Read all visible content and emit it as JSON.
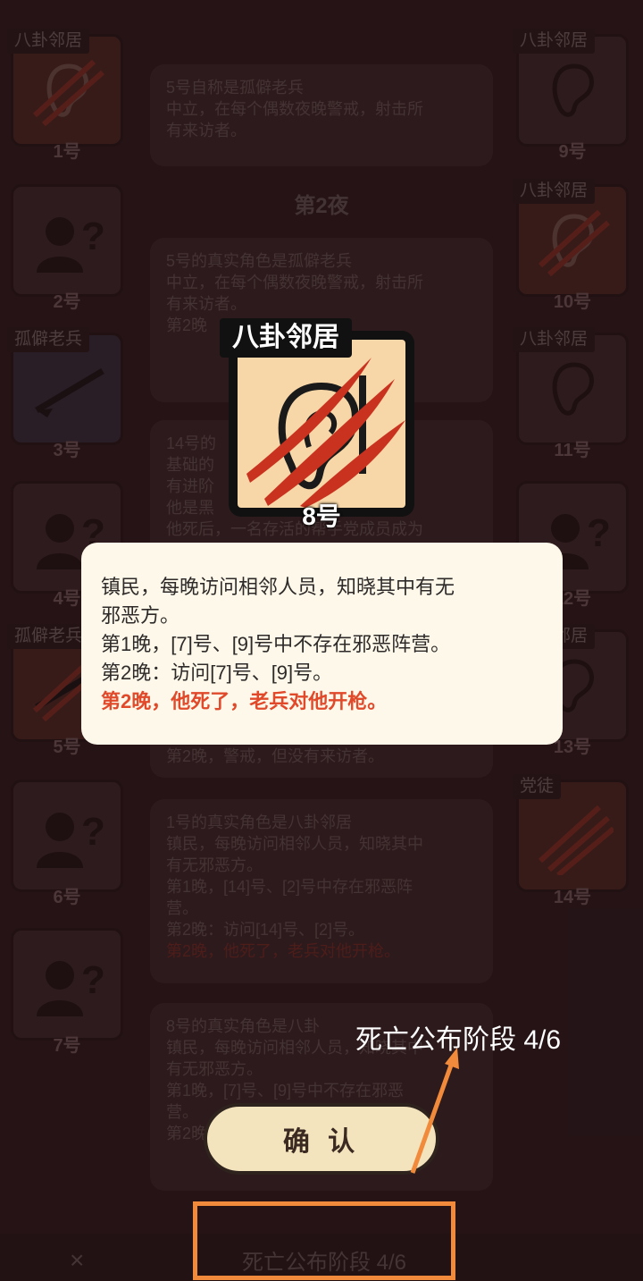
{
  "players_left": [
    {
      "num": "1号",
      "role": "八卦邻居",
      "state": "dead",
      "icon": "ear-icon"
    },
    {
      "num": "2号",
      "role": "",
      "state": "unknown",
      "icon": "unknown-person-icon"
    },
    {
      "num": "3号",
      "role": "孤僻老兵",
      "state": "alive",
      "icon": "rifle-icon"
    },
    {
      "num": "4号",
      "role": "",
      "state": "unknown",
      "icon": "unknown-person-icon"
    },
    {
      "num": "5号",
      "role": "孤僻老兵",
      "state": "dead",
      "icon": "rifle-icon"
    },
    {
      "num": "6号",
      "role": "",
      "state": "unknown",
      "icon": "unknown-person-icon"
    },
    {
      "num": "7号",
      "role": "",
      "state": "unknown",
      "icon": "unknown-person-icon"
    }
  ],
  "players_right": [
    {
      "num": "9号",
      "role": "八卦邻居",
      "state": "alive",
      "icon": "ear-icon"
    },
    {
      "num": "10号",
      "role": "八卦邻居",
      "state": "dead",
      "icon": "ear-icon"
    },
    {
      "num": "11号",
      "role": "八卦邻居",
      "state": "alive",
      "icon": "ear-icon"
    },
    {
      "num": "12号",
      "role": "",
      "state": "unknown",
      "icon": "unknown-person-icon"
    },
    {
      "num": "13号",
      "role": "八卦邻居",
      "state": "alive",
      "icon": "ear-icon"
    },
    {
      "num": "14号",
      "role": "党徒",
      "state": "dead",
      "icon": "claw-icon"
    }
  ],
  "log": {
    "entry1": [
      "5号自称是孤僻老兵",
      "中立，在每个偶数夜晚警戒，射击所",
      "有来访者。"
    ],
    "night2": "第2夜",
    "entry2": [
      "5号的真实角色是孤僻老兵",
      "中立，在每个偶数夜晚警戒，射击所",
      "有来访者。",
      "第2晚"
    ],
    "entry3": [
      "14号的",
      "基础的",
      "有进阶",
      "他是黑",
      "他死后，一名存活的帮手党成员成为"
    ],
    "entry4_tail": "第2晚，警戒，但没有来访者。",
    "entry5": [
      "1号的真实角色是八卦邻居",
      "镇民，每晚访问相邻人员，知晓其中",
      "有无邪恶方。",
      "第1晚，[14]号、[2]号中存在邪恶阵",
      "营。",
      "第2晚：访问[14]号、[2]号。"
    ],
    "entry5_red": "第2晚，他死了，老兵对他开枪。",
    "entry6": [
      "8号的真实角色是八卦",
      "镇民，每晚访问相邻人员，知晓其中",
      "有无邪恶方。",
      "第1晚，[7]号、[9]号中不存在邪恶",
      "营。",
      "第2晚"
    ]
  },
  "popup": {
    "role_tag": "八卦邻居",
    "player_num": "8号",
    "lines": [
      "镇民，每晚访问相邻人员，知晓其中有无",
      "邪恶方。",
      "第1晚，[7]号、[9]号中不存在邪恶阵营。",
      "第2晚：访问[7]号、[9]号。"
    ],
    "red_line": "第2晚，他死了，老兵对他开枪。",
    "confirm_label": "确 认"
  },
  "bottom_bar": {
    "phase_label": "死亡公布阶段 4/6",
    "close_glyph": "×"
  },
  "annotation": {
    "label": "死亡公布阶段 4/6",
    "color": "#f18a3b"
  },
  "colors": {
    "accent_red": "#e1492b",
    "card_bg": "#f7d7a7",
    "info_bg": "#fdf8e9"
  }
}
